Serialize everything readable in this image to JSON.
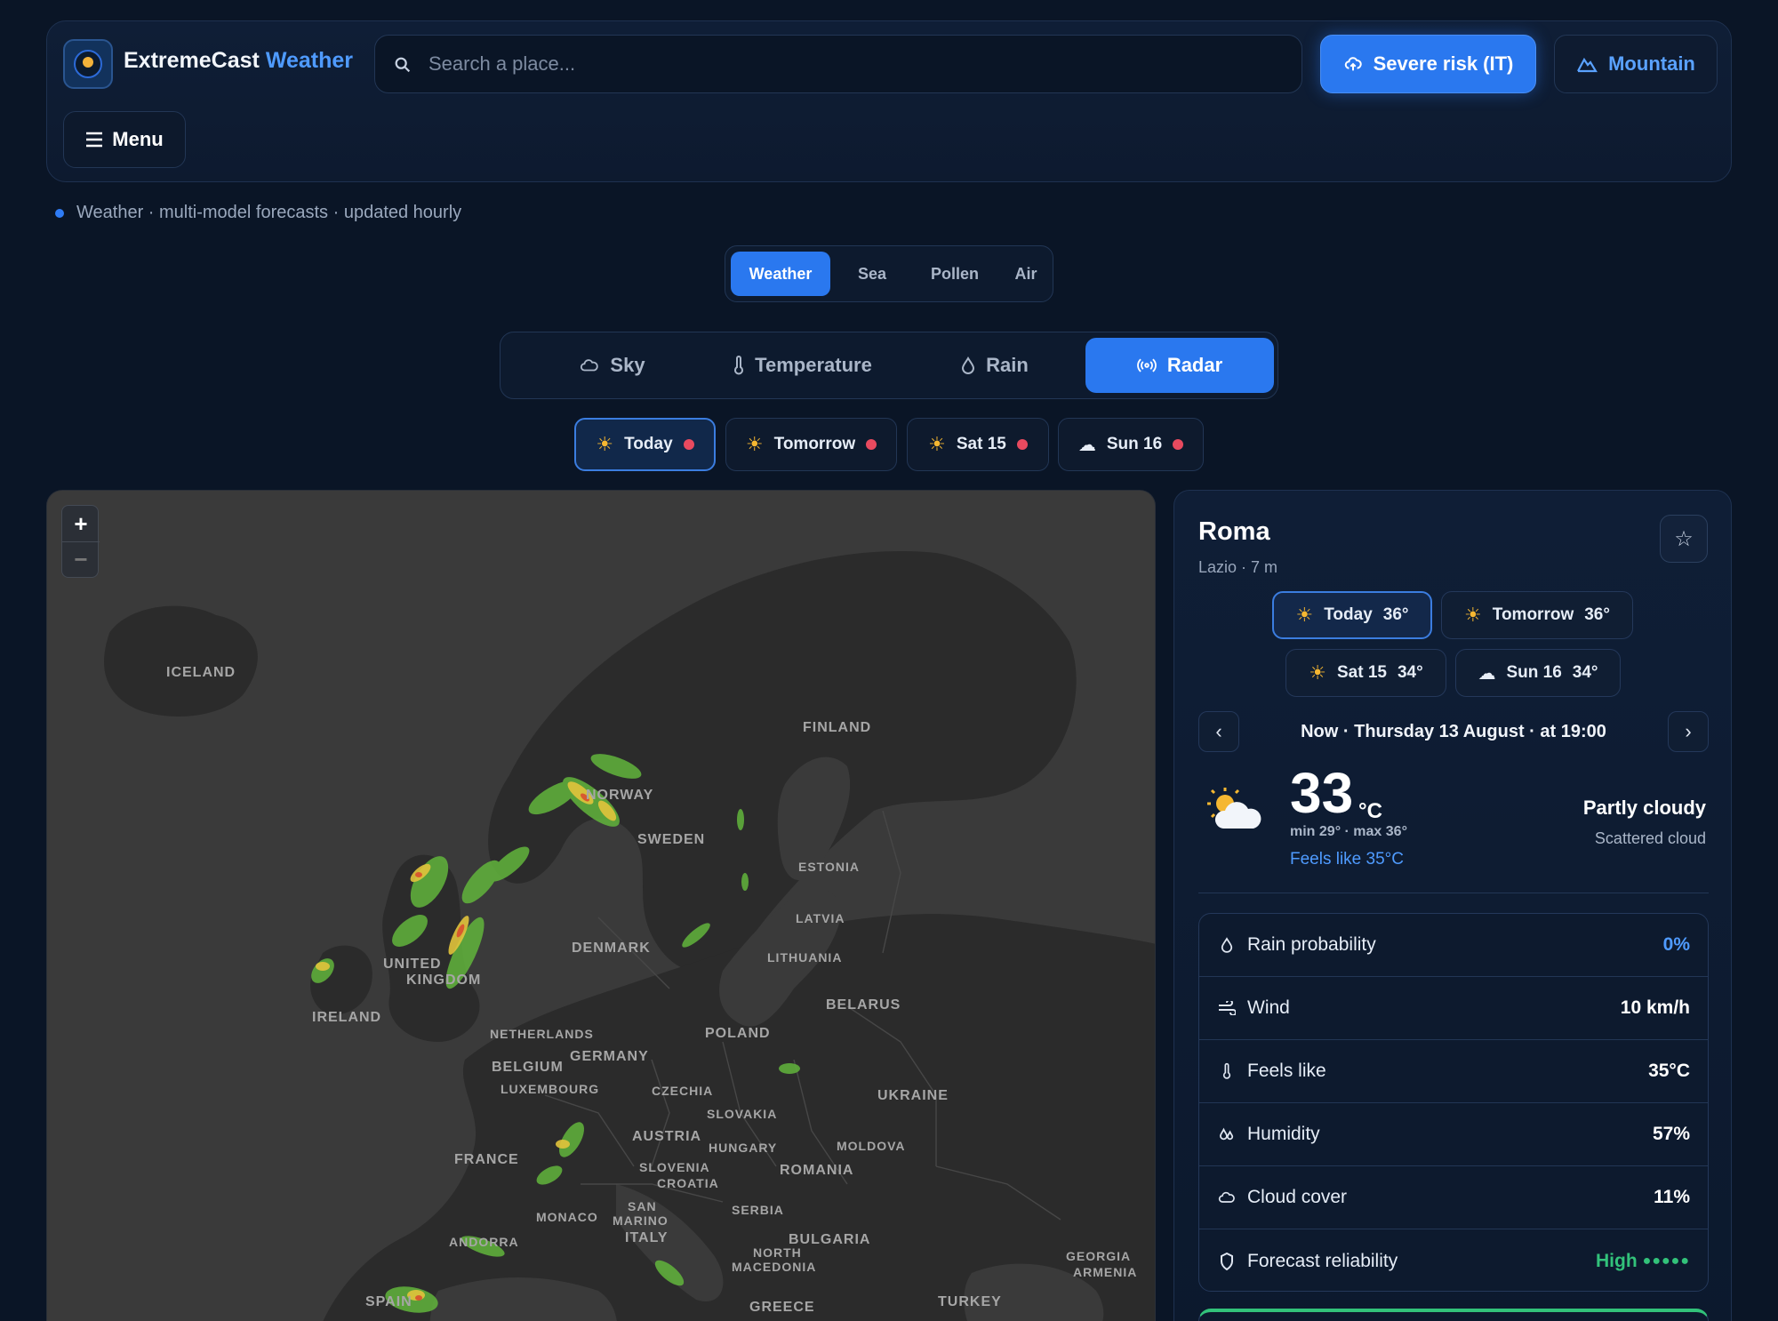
{
  "header": {
    "brand_main": "ExtremeCast",
    "brand_accent": "Weather",
    "search_placeholder": "Search a place...",
    "severe_label": "Severe risk (IT)",
    "mountain_label": "Mountain",
    "menu_label": "Menu"
  },
  "tagline": "Weather · multi-model forecasts · updated hourly",
  "domain_tabs": [
    "Weather",
    "Sea",
    "Pollen",
    "Air"
  ],
  "domain_active": "Weather",
  "layer_tabs": [
    "Sky",
    "Temperature",
    "Rain",
    "Radar"
  ],
  "layer_active": "Radar",
  "day_chips": [
    {
      "label": "Today",
      "icon": "sun-icon"
    },
    {
      "label": "Tomorrow",
      "icon": "sun-icon"
    },
    {
      "label": "Sat 15",
      "icon": "sun-icon"
    },
    {
      "label": "Sun 16",
      "icon": "cloud-icon"
    }
  ],
  "map": {
    "zoom_in": "+",
    "zoom_out": "−",
    "labels": {
      "iceland": "ICELAND",
      "finland": "FINLAND",
      "norway": "NORWAY",
      "sweden": "SWEDEN",
      "estonia": "ESTONIA",
      "latvia": "LATVIA",
      "lithuania": "LITHUANIA",
      "denmark": "DENMARK",
      "uk1": "UNITED",
      "uk2": "KINGDOM",
      "ireland": "IRELAND",
      "belarus": "BELARUS",
      "netherlands": "NETHERLANDS",
      "poland": "POLAND",
      "belgium": "BELGIUM",
      "germany": "GERMANY",
      "luxembourg": "LUXEMBOURG",
      "czechia": "CZECHIA",
      "ukraine": "UKRAINE",
      "slovakia": "SLOVAKIA",
      "austria": "AUSTRIA",
      "hungary": "HUNGARY",
      "moldova": "MOLDOVA",
      "france": "FRANCE",
      "slovenia": "SLOVENIA",
      "croatia": "CROATIA",
      "romania": "ROMANIA",
      "san_marino1": "SAN",
      "san_marino2": "MARINO",
      "monaco": "MONACO",
      "serbia": "SERBIA",
      "andorra": "ANDORRA",
      "italy": "ITALY",
      "bulgaria": "BULGARIA",
      "north_macedonia1": "NORTH",
      "north_macedonia2": "MACEDONIA",
      "georgia": "GEORGIA",
      "armenia": "ARMENIA",
      "spain": "SPAIN",
      "greece": "GREECE",
      "turkey": "TURKEY"
    }
  },
  "side": {
    "city": "Roma",
    "region": "Lazio · 7 m",
    "forecast_chips": [
      {
        "label": "Today",
        "temp": "36°",
        "icon": "sun-icon"
      },
      {
        "label": "Tomorrow",
        "temp": "36°",
        "icon": "sun-icon"
      },
      {
        "label": "Sat 15",
        "temp": "34°",
        "icon": "sun-icon"
      },
      {
        "label": "Sun 16",
        "temp": "34°",
        "icon": "cloud-icon"
      }
    ],
    "prev": "‹",
    "next": "›",
    "now_line": "Now · Thursday 13 August · at 19:00",
    "temp": "33",
    "unit": "°C",
    "minmax": "min 29° · max 36°",
    "feels": "Feels like 35°C",
    "condition": "Partly cloudy",
    "condition_sub": "Scattered cloud",
    "metrics": [
      {
        "label": "Rain probability",
        "value": "0%",
        "icon": "drop-icon"
      },
      {
        "label": "Wind",
        "value": "10 km/h",
        "icon": "wind-icon"
      },
      {
        "label": "Feels like",
        "value": "35°C",
        "icon": "thermometer-icon"
      },
      {
        "label": "Humidity",
        "value": "57%",
        "icon": "humidity-icon"
      },
      {
        "label": "Cloud cover",
        "value": "11%",
        "icon": "cloud-icon"
      },
      {
        "label": "Forecast reliability",
        "value": "High",
        "dots": "●●●●●",
        "icon": "shield-icon"
      }
    ]
  },
  "colors": {
    "accent": "#2a78ef",
    "accent_text": "#4f9bff",
    "alert_dot": "#e84a5f",
    "good": "#32c27a",
    "background": "#0a1526"
  }
}
